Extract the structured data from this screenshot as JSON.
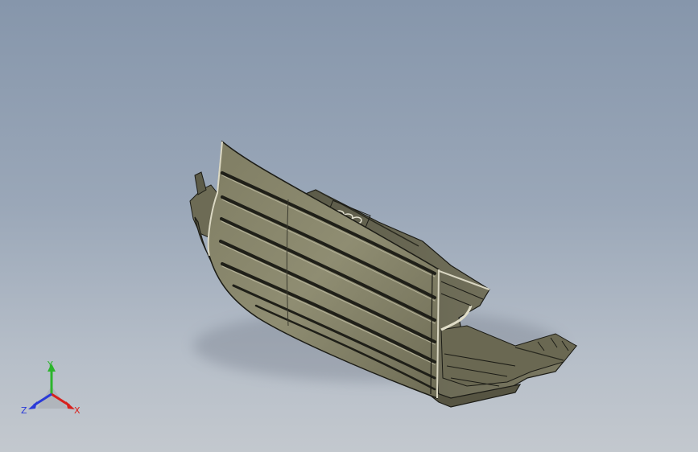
{
  "viewport": {
    "background_top": "#8696ab",
    "background_bottom": "#c3c8ce"
  },
  "model": {
    "icon": "grille-3d-model-icon",
    "body_color": "#8c8a6e",
    "edge_color": "#1c1c16"
  },
  "triad": {
    "x_label": "X",
    "y_label": "Y",
    "z_label": "Z",
    "x_color": "#d8201c",
    "y_color": "#2cb52c",
    "z_color": "#2a3ad8"
  }
}
